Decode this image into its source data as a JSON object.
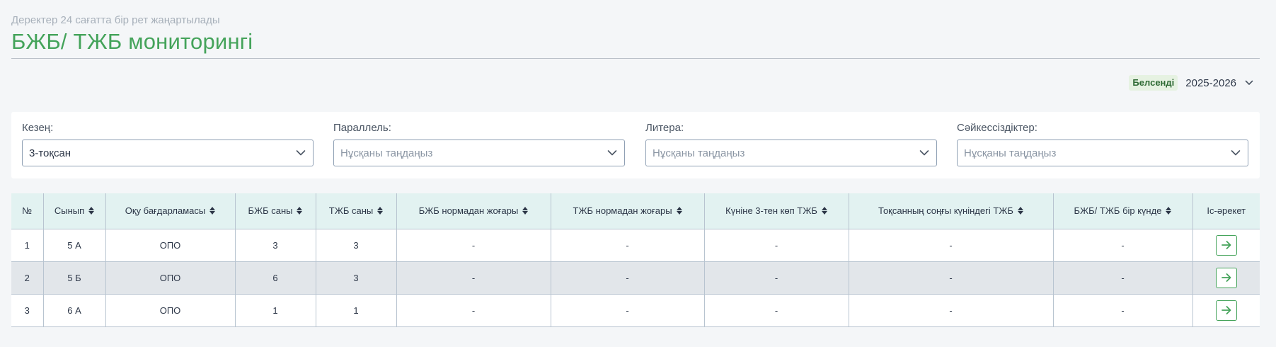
{
  "header": {
    "subtitle": "Деректер 24 сағатта бір рет жаңартылады",
    "title": "БЖБ/ ТЖБ мониторингі"
  },
  "year": {
    "badge": "Белсенді",
    "value": "2025-2026"
  },
  "filters": [
    {
      "label": "Кезең:",
      "value": "3-тоқсан",
      "placeholder": false
    },
    {
      "label": "Параллель:",
      "value": "Нұсқаны таңдаңыз",
      "placeholder": true
    },
    {
      "label": "Литера:",
      "value": "Нұсқаны таңдаңыз",
      "placeholder": true
    },
    {
      "label": "Сәйкессіздіктер:",
      "value": "Нұсқаны таңдаңыз",
      "placeholder": true
    }
  ],
  "table": {
    "columns": [
      {
        "label": "№",
        "sortable": false
      },
      {
        "label": "Сынып",
        "sortable": true
      },
      {
        "label": "Оқу бағдарламасы",
        "sortable": true
      },
      {
        "label": "БЖБ саны",
        "sortable": true
      },
      {
        "label": "ТЖБ саны",
        "sortable": true
      },
      {
        "label": "БЖБ нормадан жоғары",
        "sortable": true
      },
      {
        "label": "ТЖБ нормадан жоғары",
        "sortable": true
      },
      {
        "label": "Күніне 3-тен көп ТЖБ",
        "sortable": true
      },
      {
        "label": "Тоқсанның соңғы күніндегі ТЖБ",
        "sortable": true
      },
      {
        "label": "БЖБ/ ТЖБ бір күнде",
        "sortable": true
      },
      {
        "label": "Іс-әрекет",
        "sortable": false
      }
    ],
    "rows": [
      [
        "1",
        "5 А",
        "ОПО",
        "3",
        "3",
        "-",
        "-",
        "-",
        "-",
        "-"
      ],
      [
        "2",
        "5 Б",
        "ОПО",
        "6",
        "3",
        "-",
        "-",
        "-",
        "-",
        "-"
      ],
      [
        "3",
        "6 А",
        "ОПО",
        "1",
        "1",
        "-",
        "-",
        "-",
        "-",
        "-"
      ]
    ]
  },
  "icons": {
    "select_arrow": "chevron-down-icon",
    "sort": "sort-icon",
    "row_action": "arrow-right-icon"
  },
  "colors": {
    "accent": "#44a35a",
    "header_bg": "#e2f2f1",
    "alt_row_bg": "#e2e6ea"
  }
}
